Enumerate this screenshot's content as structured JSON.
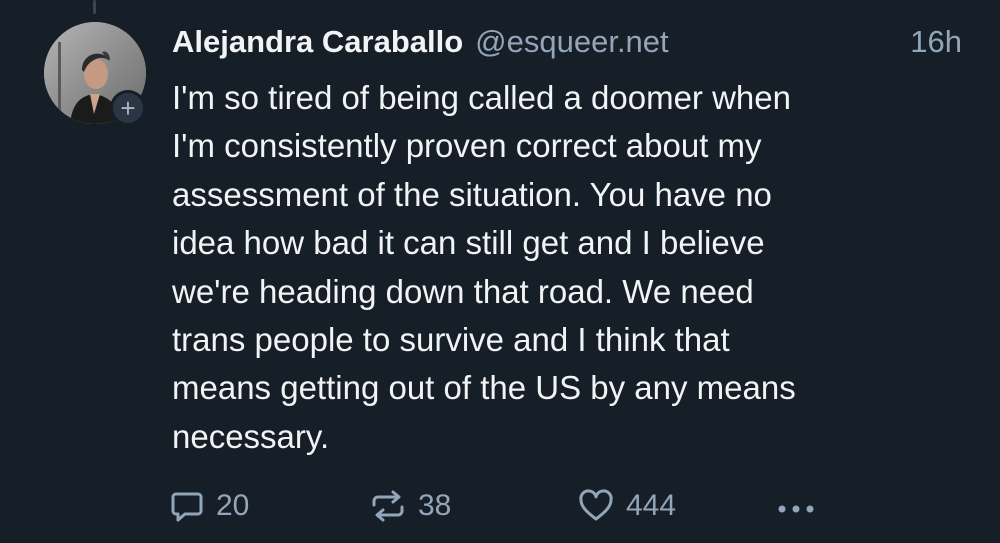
{
  "post": {
    "author": {
      "display_name": "Alejandra Caraballo",
      "handle": "@esqueer.net",
      "avatar_icon": "profile-photo",
      "follow_icon": "plus-icon",
      "follow_symbol": "+"
    },
    "timestamp": "16h",
    "text": "I'm so tired of being called a doomer when\nI'm consistently proven correct about my\nassessment of the situation. You have no\nidea how bad it can still get and I believe\nwe're heading down that road. We need\ntrans people to survive and I think that\nmeans getting out of the US by any means\nnecessary.",
    "actions": {
      "reply": {
        "icon": "reply-icon",
        "count": "20"
      },
      "repost": {
        "icon": "repost-icon",
        "count": "38"
      },
      "like": {
        "icon": "heart-icon",
        "count": "444"
      },
      "more": {
        "icon": "more-options-icon"
      }
    }
  },
  "colors": {
    "background": "#161e27",
    "text_primary": "#f1f3f5",
    "text_secondary": "#93a5b8"
  }
}
